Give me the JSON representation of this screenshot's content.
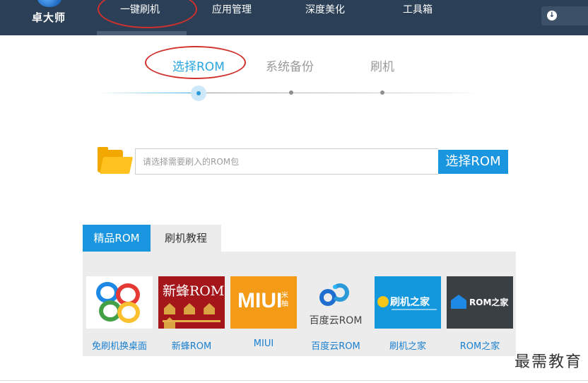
{
  "app": {
    "logo_text": "卓大师"
  },
  "nav": {
    "items": [
      "一键刷机",
      "应用管理",
      "深度美化",
      "工具箱"
    ],
    "active_index": 0
  },
  "steps": {
    "items": [
      "选择ROM",
      "系统备份",
      "刷机"
    ],
    "current": 0
  },
  "rom_picker": {
    "placeholder": "请选择需要刷入的ROM包",
    "button_label": "选择ROM"
  },
  "tabs": [
    "精品ROM",
    "刷机教程"
  ],
  "roms": [
    {
      "label": "免刷机换桌面",
      "icon": "go-launcher-icon"
    },
    {
      "label": "新蜂ROM",
      "icon": "xinfeng-rom-icon",
      "banner_title": "新蜂ROM"
    },
    {
      "label": "MIUI",
      "icon": "miui-icon",
      "banner_title": "MIUI",
      "banner_sub": "米柚"
    },
    {
      "label": "百度云ROM",
      "icon": "baidu-cloud-rom-icon",
      "banner_title": "百度云ROM"
    },
    {
      "label": "刷机之家",
      "icon": "shuaji-home-icon",
      "banner_title": "刷机之家"
    },
    {
      "label": "ROM之家",
      "icon": "rom-home-icon",
      "banner_title": "ROM之家"
    }
  ],
  "watermark": "最需教育",
  "colors": {
    "topbar": "#2b3f56",
    "accent": "#1a96e0",
    "annotation": "#d0312d",
    "panel": "#ececec"
  }
}
